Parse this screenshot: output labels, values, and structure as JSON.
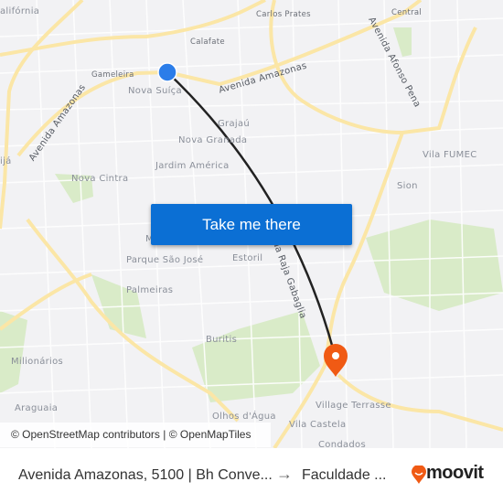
{
  "map": {
    "labels": [
      "alifórnia",
      "Carlos Prates",
      "Central",
      "Calafate",
      "Gameleira",
      "Nova Suíça",
      "Avenida Amazonas",
      "Avenida Afonso Pena",
      "Grajaú",
      "Nova Granada",
      "Jardim América",
      "Vila FUMEC",
      "Nova Cintra",
      "Sion",
      "ijá",
      "Avenida Amazonas",
      "M",
      "Parque São José",
      "Estoril",
      "da Raja Gabaglia",
      "Palmeiras",
      "Buritis",
      "Milionários",
      "Araguaia",
      "Village Terrasse",
      "Olhos d'Água",
      "Vila Castela",
      "Condados"
    ],
    "origin_color": "#2b7de9",
    "destination_color": "#f05a14",
    "route_color": "#222222"
  },
  "cta_label": "Take me there",
  "attribution": "© OpenStreetMap contributors | © OpenMapTiles",
  "footer": {
    "from": "Avenida Amazonas, 5100 | Bh Conve...",
    "arrow": "→",
    "to": "Faculdade ...",
    "brand": "moovit",
    "brand_color": "#f05a14"
  }
}
